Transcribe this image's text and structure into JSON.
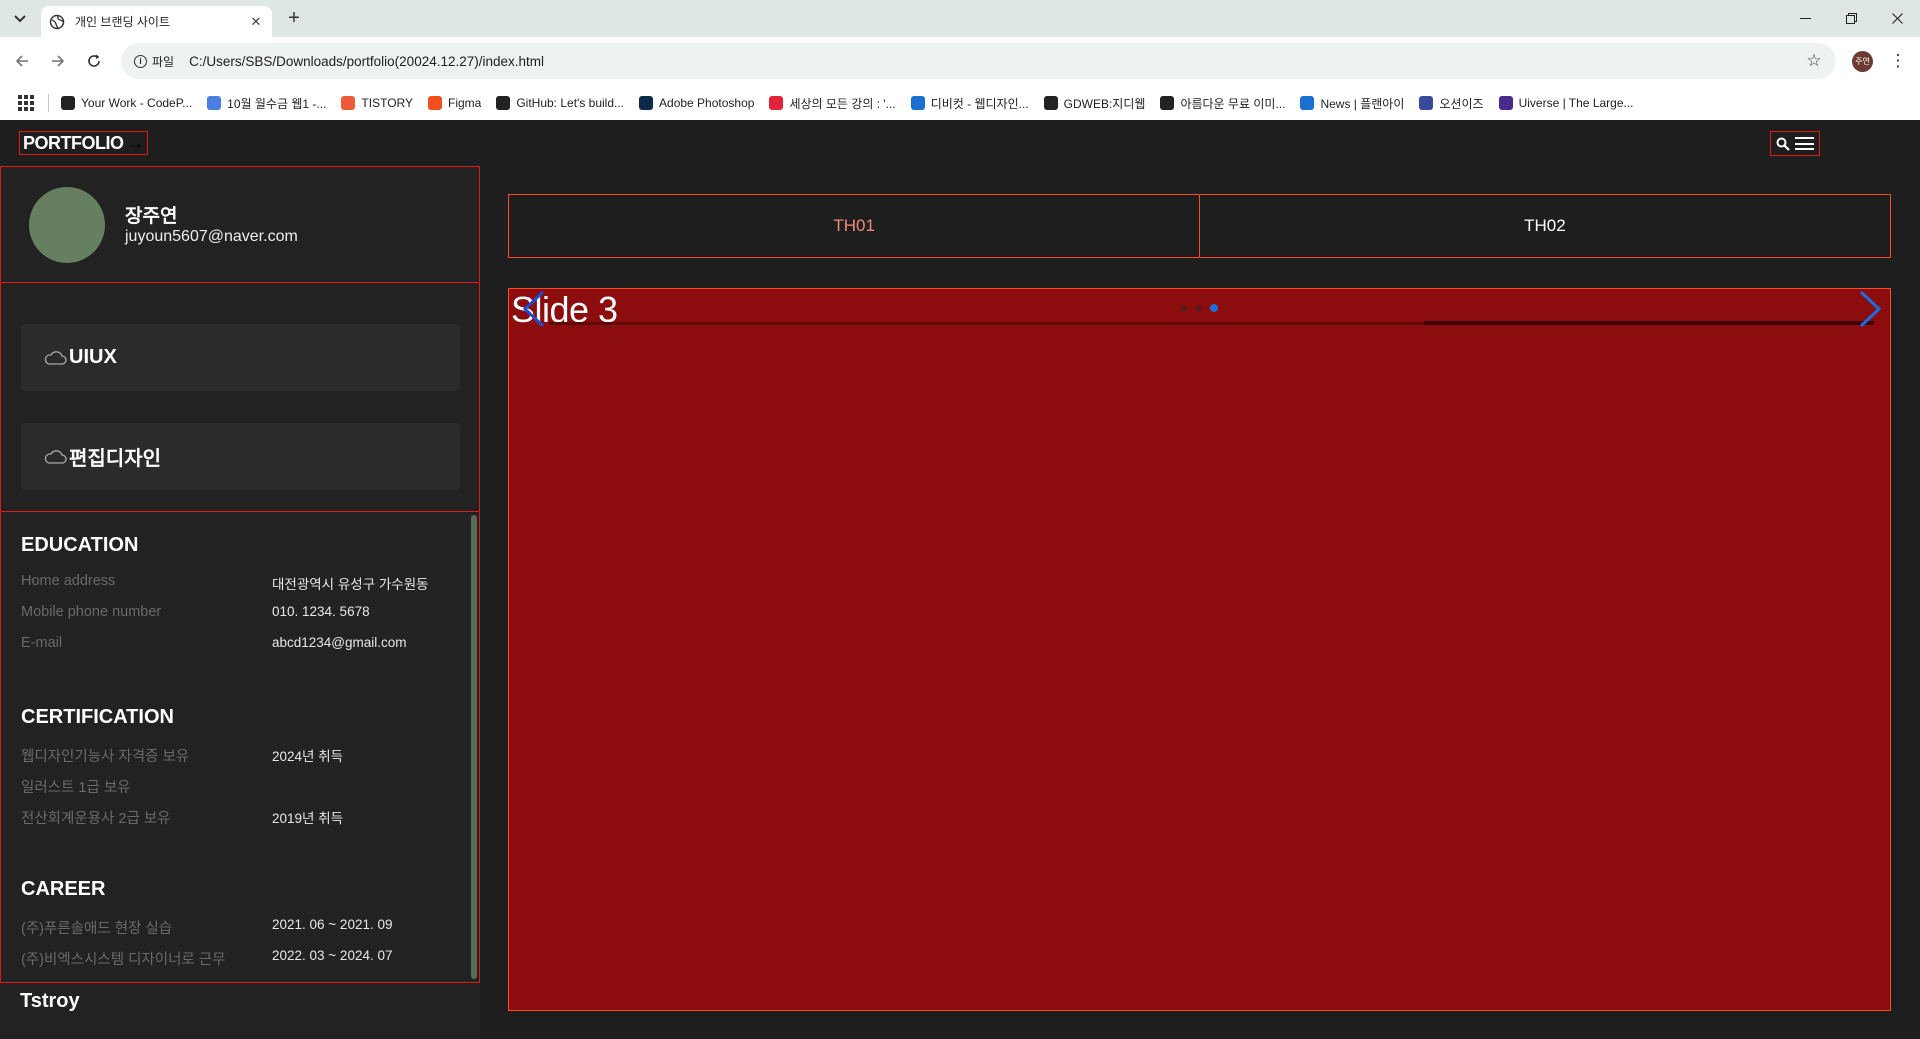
{
  "browser": {
    "tab_title": "개인 브랜딩 사이트",
    "tab_close": "✕",
    "new_tab": "+",
    "site_info_label": "파일",
    "url": "C:/Users/SBS/Downloads/portfolio(20024.12.27)/index.html",
    "profile_initials": "주연",
    "bookmarks": [
      {
        "label": "Your Work - CodeP...",
        "icon": "codepen-icon",
        "color": "#222222"
      },
      {
        "label": "10월 월수금 웹1 -...",
        "icon": "docs-icon",
        "color": "#4a7fe0"
      },
      {
        "label": "TISTORY",
        "icon": "tistory-icon",
        "color": "#ee5a3a"
      },
      {
        "label": "Figma",
        "icon": "figma-icon",
        "color": "#f24e1e"
      },
      {
        "label": "GitHub: Let's build...",
        "icon": "github-icon",
        "color": "#222222"
      },
      {
        "label": "Adobe Photoshop",
        "icon": "photoshop-icon",
        "color": "#0c2a4a"
      },
      {
        "label": "세상의 모든 강의 : '...",
        "icon": "play-icon",
        "color": "#e0243a"
      },
      {
        "label": "디비컷 - 웹디자인...",
        "icon": "dbcut-icon",
        "color": "#1a6fd0"
      },
      {
        "label": "GDWEB:지디웹",
        "icon": "gdweb-icon",
        "color": "#222222"
      },
      {
        "label": "아름다운 무료 이미...",
        "icon": "unsplash-icon",
        "color": "#222222"
      },
      {
        "label": "News | 플랜아이",
        "icon": "info-icon",
        "color": "#1a6fd0"
      },
      {
        "label": "오션이즈",
        "icon": "oceanis-icon",
        "color": "#3a4a9a"
      },
      {
        "label": "Uiverse | The Large...",
        "icon": "uiverse-icon",
        "color": "#4a2a8a"
      }
    ]
  },
  "header": {
    "logo": "PORTFOLIO",
    "logo_arrow": "→"
  },
  "profile": {
    "name": "장주연",
    "email": "juyoun5607@naver.com"
  },
  "categories": [
    {
      "label": "UIUX",
      "icon": "cloud-icon"
    },
    {
      "label": "편집디자인",
      "icon": "cloud-icon"
    }
  ],
  "education": {
    "title": "EDUCATION",
    "rows": [
      {
        "key": "Home address",
        "value": "대전광역시 유성구 가수원동"
      },
      {
        "key": "Mobile phone number",
        "value": "010. 1234. 5678"
      },
      {
        "key": "E-mail",
        "value": "abcd1234@gmail.com"
      }
    ]
  },
  "certification": {
    "title": "CERTIFICATION",
    "rows": [
      {
        "key": "웹디자인기능사 자격증 보유",
        "value": "2024년 취득"
      },
      {
        "key": "일러스트 1급 보유",
        "value": ""
      },
      {
        "key": "전산회계운용사 2급 보유",
        "value": "2019년 취득"
      }
    ]
  },
  "career": {
    "title": "CAREER",
    "rows": [
      {
        "key": "(주)푸른솔애드 현장 실습",
        "value": "2021. 06 ~ 2021. 09"
      },
      {
        "key": "(주)비엑스시스템 디자이너로 근무",
        "value": "2022. 03 ~ 2024. 07"
      }
    ]
  },
  "footer_label": "Tstroy",
  "main": {
    "tabs": [
      "TH01",
      "TH02"
    ],
    "slide_label": "Slide 3",
    "slide_count": 3,
    "active_slide": 3
  },
  "colors": {
    "accent_border": "#ff4a26",
    "outline_red": "#e01818",
    "slide_bg": "#8d0d0e",
    "avatar": "#667f5e",
    "active_dot": "#1a6fe0"
  }
}
